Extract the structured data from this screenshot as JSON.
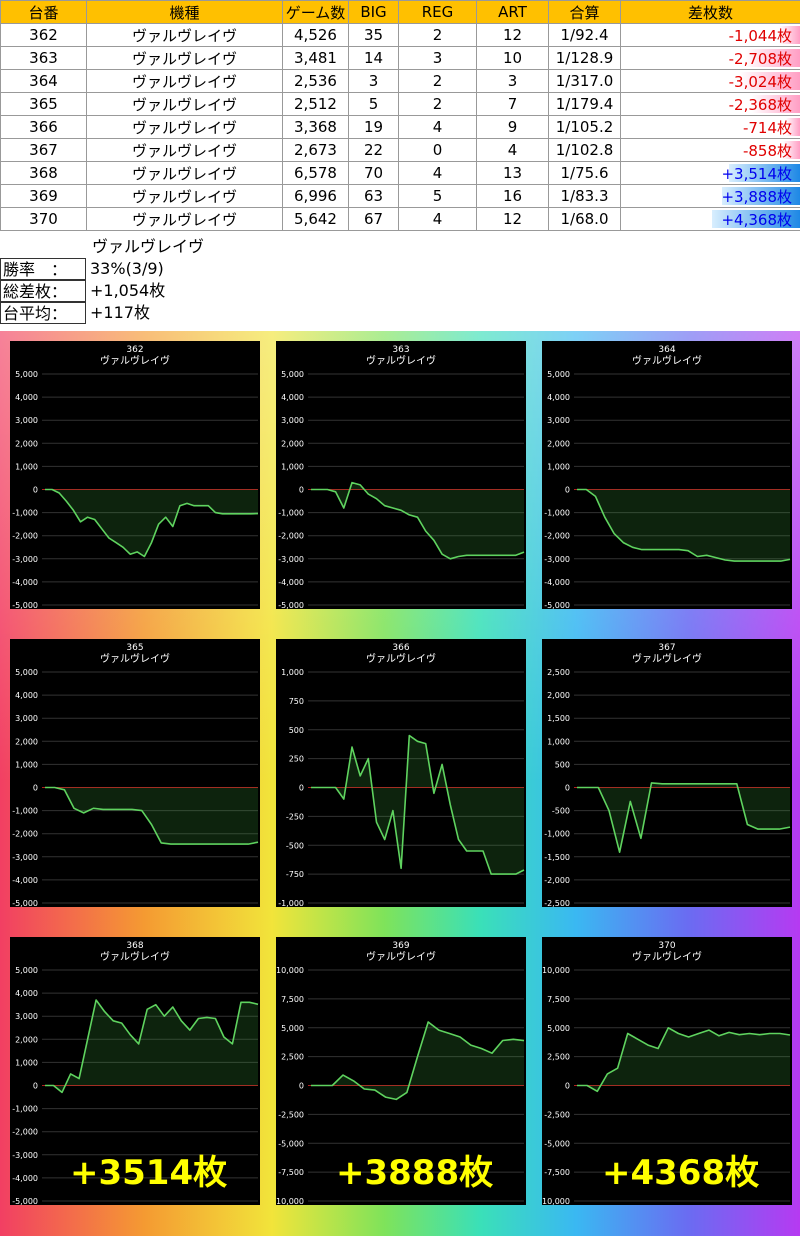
{
  "table": {
    "headers": [
      "台番",
      "機種",
      "ゲーム数",
      "BIG",
      "REG",
      "ART",
      "合算",
      "差枚数"
    ],
    "rows": [
      {
        "no": "362",
        "machine": "ヴァルヴレイヴ",
        "games": "4,526",
        "big": "35",
        "reg": "2",
        "art": "12",
        "ratio": "1/92.4",
        "diff": "-1,044枚",
        "diff_value": -1044
      },
      {
        "no": "363",
        "machine": "ヴァルヴレイヴ",
        "games": "3,481",
        "big": "14",
        "reg": "3",
        "art": "10",
        "ratio": "1/128.9",
        "diff": "-2,708枚",
        "diff_value": -2708
      },
      {
        "no": "364",
        "machine": "ヴァルヴレイヴ",
        "games": "2,536",
        "big": "3",
        "reg": "2",
        "art": "3",
        "ratio": "1/317.0",
        "diff": "-3,024枚",
        "diff_value": -3024
      },
      {
        "no": "365",
        "machine": "ヴァルヴレイヴ",
        "games": "2,512",
        "big": "5",
        "reg": "2",
        "art": "7",
        "ratio": "1/179.4",
        "diff": "-2,368枚",
        "diff_value": -2368
      },
      {
        "no": "366",
        "machine": "ヴァルヴレイヴ",
        "games": "3,368",
        "big": "19",
        "reg": "4",
        "art": "9",
        "ratio": "1/105.2",
        "diff": "-714枚",
        "diff_value": -714
      },
      {
        "no": "367",
        "machine": "ヴァルヴレイヴ",
        "games": "2,673",
        "big": "22",
        "reg": "0",
        "art": "4",
        "ratio": "1/102.8",
        "diff": "-858枚",
        "diff_value": -858
      },
      {
        "no": "368",
        "machine": "ヴァルヴレイヴ",
        "games": "6,578",
        "big": "70",
        "reg": "4",
        "art": "13",
        "ratio": "1/75.6",
        "diff": "+3,514枚",
        "diff_value": 3514
      },
      {
        "no": "369",
        "machine": "ヴァルヴレイヴ",
        "games": "6,996",
        "big": "63",
        "reg": "5",
        "art": "16",
        "ratio": "1/83.3",
        "diff": "+3,888枚",
        "diff_value": 3888
      },
      {
        "no": "370",
        "machine": "ヴァルヴレイヴ",
        "games": "5,642",
        "big": "67",
        "reg": "4",
        "art": "12",
        "ratio": "1/68.0",
        "diff": "+4,368枚",
        "diff_value": 4368
      }
    ]
  },
  "summary": {
    "machine": "ヴァルヴレイヴ",
    "win_rate_label": "勝率　：",
    "win_rate": "33%(3/9)",
    "total_label": "総差枚：",
    "total": "+1,054枚",
    "avg_label": "台平均：",
    "avg": "+117枚"
  },
  "colors": {
    "line": "#5fd35f",
    "zero_line": "#b02020",
    "grid": "#333333",
    "text": "#ffffff",
    "highlight": "#ffff00"
  },
  "chart_data": [
    {
      "type": "line",
      "title": "362",
      "subtitle": "ヴァルヴレイヴ",
      "ylim": [
        -5000,
        5000
      ],
      "yticks": [
        "5,000",
        "4,000",
        "3,000",
        "2,000",
        "1,000",
        "0",
        "-1,000",
        "-2,000",
        "-3,000",
        "-4,000",
        "-5,000"
      ],
      "tickvals": [
        5000,
        4000,
        3000,
        2000,
        1000,
        0,
        -1000,
        -2000,
        -3000,
        -4000,
        -5000
      ],
      "y": [
        0,
        0,
        -150,
        -500,
        -900,
        -1400,
        -1200,
        -1300,
        -1700,
        -2100,
        -2300,
        -2500,
        -2800,
        -2700,
        -2900,
        -2300,
        -1500,
        -1200,
        -1600,
        -700,
        -600,
        -700,
        -700,
        -700,
        -1000,
        -1050,
        -1050,
        -1050,
        -1050,
        -1050,
        -1044
      ],
      "highlight": ""
    },
    {
      "type": "line",
      "title": "363",
      "subtitle": "ヴァルヴレイヴ",
      "ylim": [
        -5000,
        5000
      ],
      "yticks": [
        "5,000",
        "4,000",
        "3,000",
        "2,000",
        "1,000",
        "0",
        "-1,000",
        "-2,000",
        "-3,000",
        "-4,000",
        "-5,000"
      ],
      "tickvals": [
        5000,
        4000,
        3000,
        2000,
        1000,
        0,
        -1000,
        -2000,
        -3000,
        -4000,
        -5000
      ],
      "y": [
        0,
        0,
        0,
        -100,
        -800,
        300,
        200,
        -200,
        -400,
        -700,
        -800,
        -900,
        -1100,
        -1200,
        -1800,
        -2200,
        -2800,
        -3000,
        -2900,
        -2850,
        -2850,
        -2850,
        -2850,
        -2850,
        -2850,
        -2850,
        -2708
      ],
      "highlight": ""
    },
    {
      "type": "line",
      "title": "364",
      "subtitle": "ヴァルヴレイヴ",
      "ylim": [
        -5000,
        5000
      ],
      "yticks": [
        "5,000",
        "4,000",
        "3,000",
        "2,000",
        "1,000",
        "0",
        "-1,000",
        "-2,000",
        "-3,000",
        "-4,000",
        "-5,000"
      ],
      "tickvals": [
        5000,
        4000,
        3000,
        2000,
        1000,
        0,
        -1000,
        -2000,
        -3000,
        -4000,
        -5000
      ],
      "y": [
        0,
        0,
        -300,
        -1200,
        -1900,
        -2300,
        -2500,
        -2600,
        -2600,
        -2600,
        -2600,
        -2600,
        -2650,
        -2900,
        -2850,
        -2950,
        -3050,
        -3100,
        -3100,
        -3100,
        -3100,
        -3100,
        -3100,
        -3024
      ],
      "highlight": ""
    },
    {
      "type": "line",
      "title": "365",
      "subtitle": "ヴァルヴレイヴ",
      "ylim": [
        -5000,
        5000
      ],
      "yticks": [
        "5,000",
        "4,000",
        "3,000",
        "2,000",
        "1,000",
        "0",
        "-1,000",
        "-2,000",
        "-3,000",
        "-4,000",
        "-5,000"
      ],
      "tickvals": [
        5000,
        4000,
        3000,
        2000,
        1000,
        0,
        -1000,
        -2000,
        -3000,
        -4000,
        -5000
      ],
      "y": [
        0,
        0,
        -100,
        -900,
        -1100,
        -900,
        -950,
        -950,
        -950,
        -950,
        -1000,
        -1600,
        -2400,
        -2450,
        -2450,
        -2450,
        -2450,
        -2450,
        -2450,
        -2450,
        -2450,
        -2450,
        -2368
      ],
      "highlight": ""
    },
    {
      "type": "line",
      "title": "366",
      "subtitle": "ヴァルヴレイヴ",
      "ylim": [
        -1000,
        1000
      ],
      "yticks": [
        "1,000",
        "750",
        "500",
        "250",
        "0",
        "-250",
        "-500",
        "-750",
        "-1,000"
      ],
      "tickvals": [
        1000,
        750,
        500,
        250,
        0,
        -250,
        -500,
        -750,
        -1000
      ],
      "y": [
        0,
        0,
        0,
        0,
        -100,
        350,
        100,
        250,
        -300,
        -450,
        -200,
        -700,
        450,
        400,
        380,
        -50,
        200,
        -150,
        -450,
        -550,
        -550,
        -550,
        -750,
        -750,
        -750,
        -750,
        -714
      ],
      "highlight": ""
    },
    {
      "type": "line",
      "title": "367",
      "subtitle": "ヴァルヴレイヴ",
      "ylim": [
        -2500,
        2500
      ],
      "yticks": [
        "2,500",
        "2,000",
        "1,500",
        "1,000",
        "500",
        "0",
        "-500",
        "-1,000",
        "-1,500",
        "-2,000",
        "-2,500"
      ],
      "tickvals": [
        2500,
        2000,
        1500,
        1000,
        500,
        0,
        -500,
        -1000,
        -1500,
        -2000,
        -2500
      ],
      "y": [
        0,
        0,
        0,
        -500,
        -1400,
        -300,
        -1100,
        100,
        80,
        80,
        80,
        80,
        80,
        80,
        80,
        80,
        -800,
        -900,
        -900,
        -900,
        -858
      ],
      "highlight": ""
    },
    {
      "type": "line",
      "title": "368",
      "subtitle": "ヴァルヴレイヴ",
      "ylim": [
        -5000,
        5000
      ],
      "yticks": [
        "5,000",
        "4,000",
        "3,000",
        "2,000",
        "1,000",
        "0",
        "-1,000",
        "-2,000",
        "-3,000",
        "-4,000",
        "-5,000"
      ],
      "tickvals": [
        5000,
        4000,
        3000,
        2000,
        1000,
        0,
        -1000,
        -2000,
        -3000,
        -4000,
        -5000
      ],
      "y": [
        0,
        0,
        -300,
        500,
        300,
        2000,
        3700,
        3200,
        2800,
        2700,
        2200,
        1800,
        3300,
        3500,
        3000,
        3400,
        2800,
        2400,
        2900,
        2950,
        2900,
        2100,
        1800,
        3600,
        3600,
        3514
      ],
      "highlight": "+3514枚"
    },
    {
      "type": "line",
      "title": "369",
      "subtitle": "ヴァルヴレイヴ",
      "ylim": [
        -10000,
        10000
      ],
      "yticks": [
        "10,000",
        "7,500",
        "5,000",
        "2,500",
        "0",
        "-2,500",
        "-5,000",
        "-7,500",
        "-10,000"
      ],
      "tickvals": [
        10000,
        7500,
        5000,
        2500,
        0,
        -2500,
        -5000,
        -7500,
        -10000
      ],
      "y": [
        0,
        0,
        0,
        900,
        400,
        -300,
        -400,
        -1000,
        -1200,
        -600,
        2500,
        5500,
        4800,
        4500,
        4200,
        3500,
        3200,
        2800,
        3900,
        4000,
        3888
      ],
      "highlight": "+3888枚"
    },
    {
      "type": "line",
      "title": "370",
      "subtitle": "ヴァルヴレイヴ",
      "ylim": [
        -10000,
        10000
      ],
      "yticks": [
        "10,000",
        "7,500",
        "5,000",
        "2,500",
        "0",
        "-2,500",
        "-5,000",
        "-7,500",
        "-10,000"
      ],
      "tickvals": [
        10000,
        7500,
        5000,
        2500,
        0,
        -2500,
        -5000,
        -7500,
        -10000
      ],
      "y": [
        0,
        0,
        -500,
        1000,
        1500,
        4500,
        4000,
        3500,
        3200,
        5000,
        4500,
        4200,
        4500,
        4800,
        4300,
        4600,
        4400,
        4500,
        4400,
        4500,
        4500,
        4368
      ],
      "highlight": "+4368枚"
    }
  ]
}
